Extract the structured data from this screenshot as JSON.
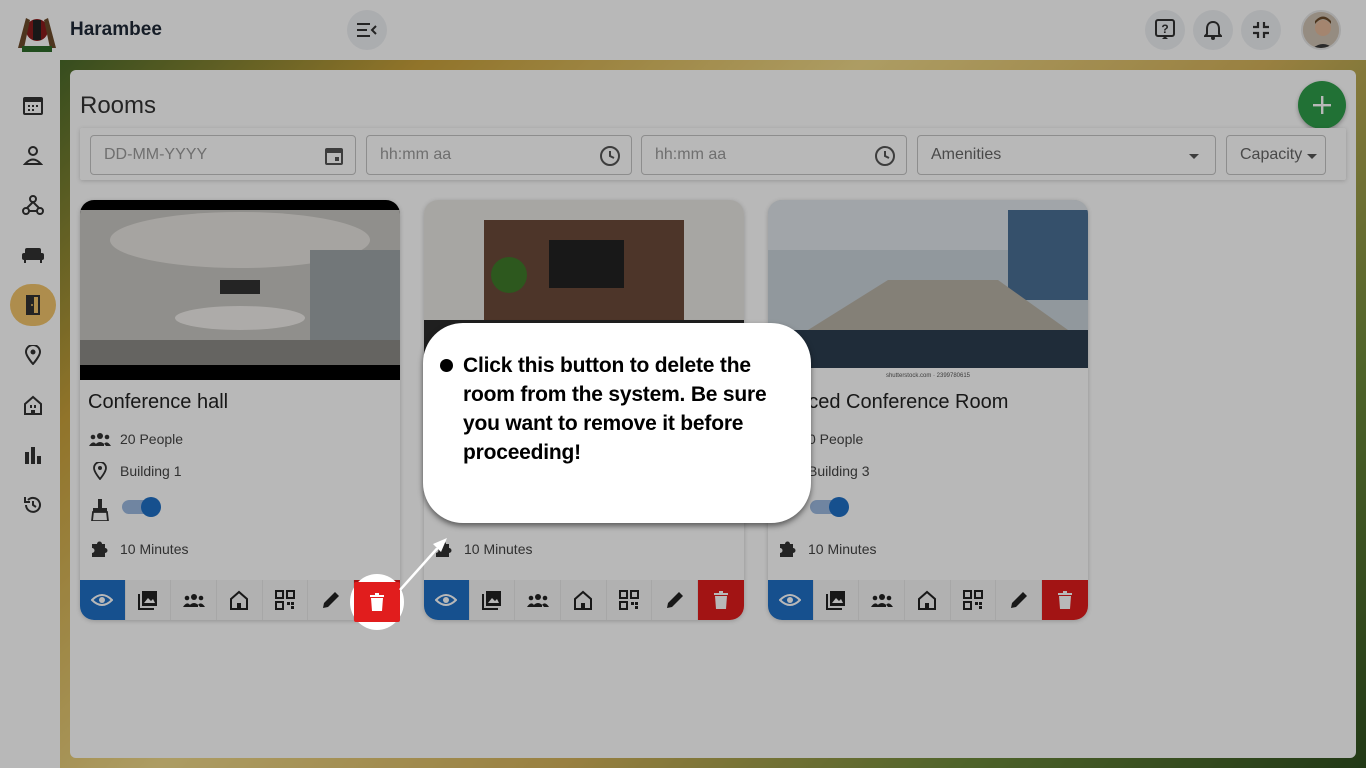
{
  "app": {
    "title": "Harambee"
  },
  "page": {
    "title": "Rooms"
  },
  "filters": {
    "date_placeholder": "DD-MM-YYYY",
    "start_time_placeholder": "hh:mm aa",
    "end_time_placeholder": "hh:mm aa",
    "amenities_label": "Amenities",
    "capacity_label": "Capacity"
  },
  "cards": [
    {
      "name": "Conference hall",
      "capacity": "20 People",
      "location": "Building 1",
      "buffer": "10 Minutes",
      "cleaning_enabled": true
    },
    {
      "name": "",
      "capacity": "",
      "location": "",
      "buffer": "10 Minutes",
      "cleaning_enabled": true
    },
    {
      "name": "vanced Conference Room",
      "capacity": "0 People",
      "location": "Building 3",
      "buffer": "10 Minutes",
      "cleaning_enabled": true,
      "image_caption": "shutterstock.com · 2399780615"
    }
  ],
  "tour": {
    "text": "Click this button to delete the room from the system. Be sure you want to remove it before proceeding!"
  },
  "colors": {
    "primary": "#1f6fc5",
    "danger": "#e11d1d",
    "add": "#2e9d4a",
    "active_nav": "#f2c46b"
  },
  "icons": {
    "sidebar": [
      "calendar-icon",
      "person-icon",
      "network-icon",
      "sofa-icon",
      "door-icon",
      "location-pin-icon",
      "building-icon",
      "bar-chart-icon",
      "history-icon"
    ],
    "card_actions": [
      "eye-icon",
      "image-gallery-icon",
      "people-icon",
      "building-icon",
      "qr-code-icon",
      "pencil-icon",
      "trash-icon"
    ]
  }
}
